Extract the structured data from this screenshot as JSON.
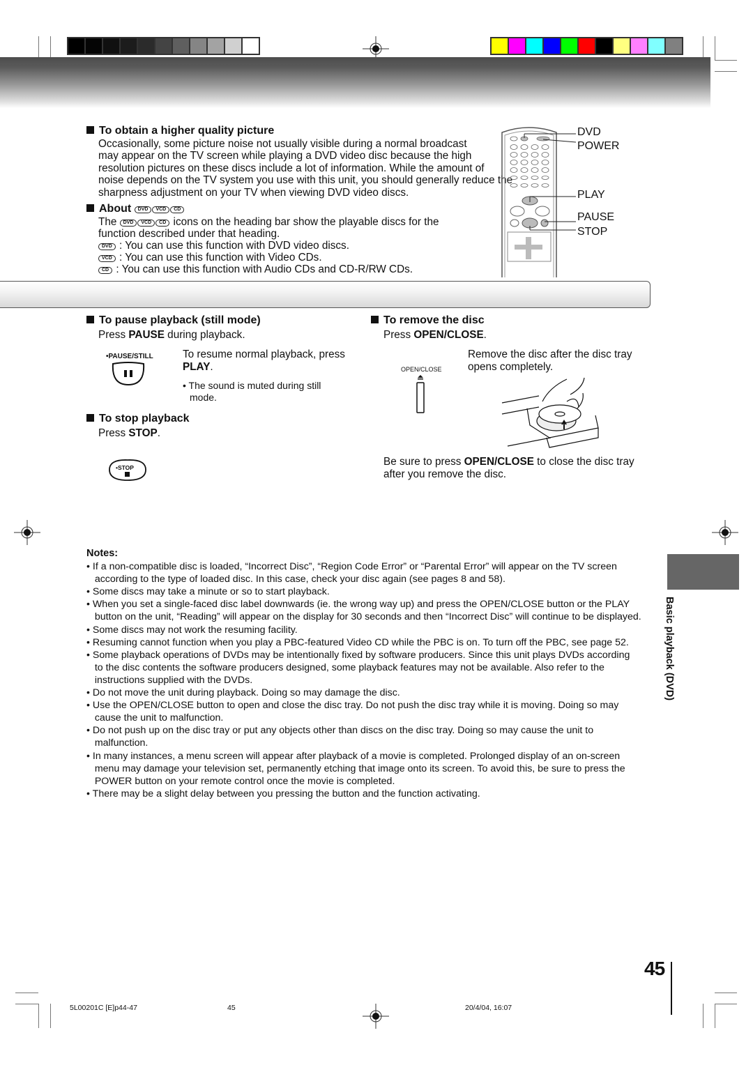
{
  "calibration": {
    "gray": [
      "#000000",
      "#050505",
      "#101010",
      "#1c1c1c",
      "#2b2b2b",
      "#444444",
      "#5f5f5f",
      "#858585",
      "#a3a3a3",
      "#d0d0d0",
      "#ffffff"
    ],
    "color": [
      "#ffff00",
      "#ff00ff",
      "#00ffff",
      "#0000ff",
      "#00ff00",
      "#ff0000",
      "#000000",
      "#ffff80",
      "#ff80ff",
      "#80ffff",
      "#808080"
    ]
  },
  "higher_quality": {
    "heading": "To obtain a higher quality picture",
    "lines": [
      "Occasionally, some picture noise not usually visible during a normal broadcast",
      "may appear on the TV screen while playing a DVD video disc because the high",
      "resolution pictures on these discs include a lot of information. While the amount of",
      "noise depends on the TV system you use with this unit, you should generally reduce the",
      "sharpness adjustment on your TV when viewing DVD video discs."
    ]
  },
  "about": {
    "heading": "About",
    "badges": [
      "DVD",
      "VCD",
      "CD"
    ],
    "intro_prefix": "The",
    "intro_rest": "icons on the heading bar show the playable discs for the",
    "intro_line2": "function described under that heading.",
    "items": [
      {
        "badge": "DVD",
        "text": ": You can use this function with DVD video discs."
      },
      {
        "badge": "VCD",
        "text": ": You can use this function with Video CDs."
      },
      {
        "badge": "CD",
        "text": ": You can use this function with Audio CDs and CD-R/RW CDs."
      }
    ]
  },
  "remote_labels": [
    "DVD",
    "POWER",
    "PLAY",
    "PAUSE",
    "STOP"
  ],
  "pause": {
    "heading": "To pause playback (still mode)",
    "press": "Press ",
    "key": "PAUSE",
    "press_rest": " during playback.",
    "button_label": "•PAUSE/STILL",
    "resume1": "To resume normal playback, press",
    "resume_key": "PLAY",
    "resume_end": ".",
    "note1": "• The sound is muted during still",
    "note2": "mode."
  },
  "stop": {
    "heading": "To stop playback",
    "press": "Press ",
    "key": "STOP",
    "end": ".",
    "button_label": "•STOP"
  },
  "remove": {
    "heading": "To remove the disc",
    "press": "Press ",
    "key": "OPEN/CLOSE",
    "end": ".",
    "button_label": "OPEN/CLOSE",
    "desc1": "Remove the disc after the disc tray",
    "desc2": "opens completely.",
    "close1_pre": "Be sure to press ",
    "close1_key": "OPEN/CLOSE",
    "close1_post": " to close the disc tray",
    "close2": "after you remove the disc."
  },
  "notes": {
    "heading": "Notes:",
    "lines": [
      "• If a non-compatible disc is loaded, “Incorrect Disc”, “Region Code Error” or “Parental Error” will appear on the TV screen",
      "   according to the type of loaded disc. In this case, check your disc again (see pages 8 and 58).",
      "• Some discs may take a minute or so to start playback.",
      "• When you set a single-faced disc label downwards (ie. the wrong way up) and press the OPEN/CLOSE button or the PLAY",
      "   button on the unit, “Reading” will appear on the display for 30 seconds and then “Incorrect Disc” will continue to be displayed.",
      "• Some discs may not work the resuming facility.",
      "• Resuming cannot function when you play a PBC-featured Video CD while the PBC is on. To turn off the PBC, see page 52.",
      "• Some playback operations of DVDs may be intentionally fixed by software producers. Since this unit plays DVDs according",
      "   to the disc contents the software producers designed, some playback features may not be available. Also refer to the",
      "   instructions supplied with the DVDs.",
      "• Do not move the unit during playback. Doing so may damage the disc.",
      "• Use the OPEN/CLOSE button to open and close the disc tray. Do not push the disc tray while it is moving. Doing so may",
      "   cause the unit to malfunction.",
      "• Do not push up on the disc tray or put any objects other than discs on the disc tray. Doing so may cause the unit to",
      "   malfunction.",
      "• In many instances, a menu screen will appear after playback of a movie is completed. Prolonged display of an on-screen",
      "   menu may damage your television set, permanently etching that image onto its screen. To avoid this, be sure to press the",
      "   POWER button on your remote control once the movie is completed.",
      "• There may be a slight delay between you pressing the button and the function activating."
    ]
  },
  "side_tab": "Basic playback (DVD)",
  "page_number": "45",
  "footer": {
    "code": "5L00201C [E]p44-47",
    "page": "45",
    "date": "20/4/04, 16:07"
  }
}
